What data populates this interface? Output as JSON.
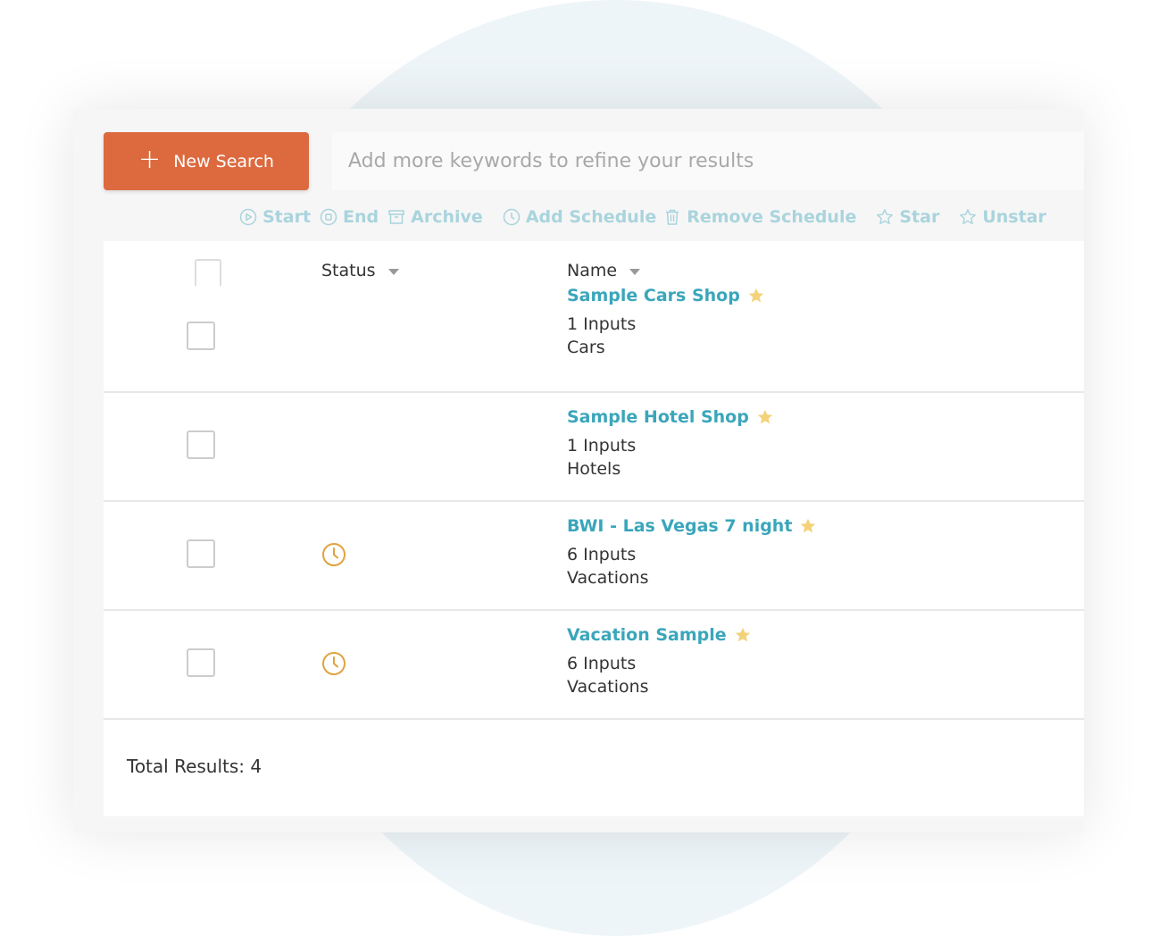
{
  "toolbar": {
    "new_search_label": "New Search",
    "search_placeholder": "Add more keywords to refine your results",
    "actions": {
      "start": "Start",
      "end": "End",
      "archive": "Archive",
      "add_schedule": "Add Schedule",
      "remove_schedule": "Remove Schedule",
      "star": "Star",
      "unstar": "Unstar"
    }
  },
  "table": {
    "headers": {
      "status": "Status",
      "name": "Name"
    },
    "rows": [
      {
        "name": "Sample Cars Shop",
        "inputs": "1 Inputs",
        "category": "Cars",
        "scheduled": false,
        "starred": true
      },
      {
        "name": "Sample Hotel Shop",
        "inputs": "1 Inputs",
        "category": "Hotels",
        "scheduled": false,
        "starred": true
      },
      {
        "name": "BWI - Las Vegas 7 night",
        "inputs": "6 Inputs",
        "category": "Vacations",
        "scheduled": true,
        "starred": true
      },
      {
        "name": "Vacation Sample",
        "inputs": "6 Inputs",
        "category": "Vacations",
        "scheduled": true,
        "starred": true
      }
    ]
  },
  "footer": {
    "total": "Total Results: 4"
  },
  "colors": {
    "accent": "#dd6a3f",
    "link": "#3aa6bb",
    "toolbar_disabled": "#a9d4dd",
    "clock": "#e0a340",
    "star": "#f3d27a"
  }
}
